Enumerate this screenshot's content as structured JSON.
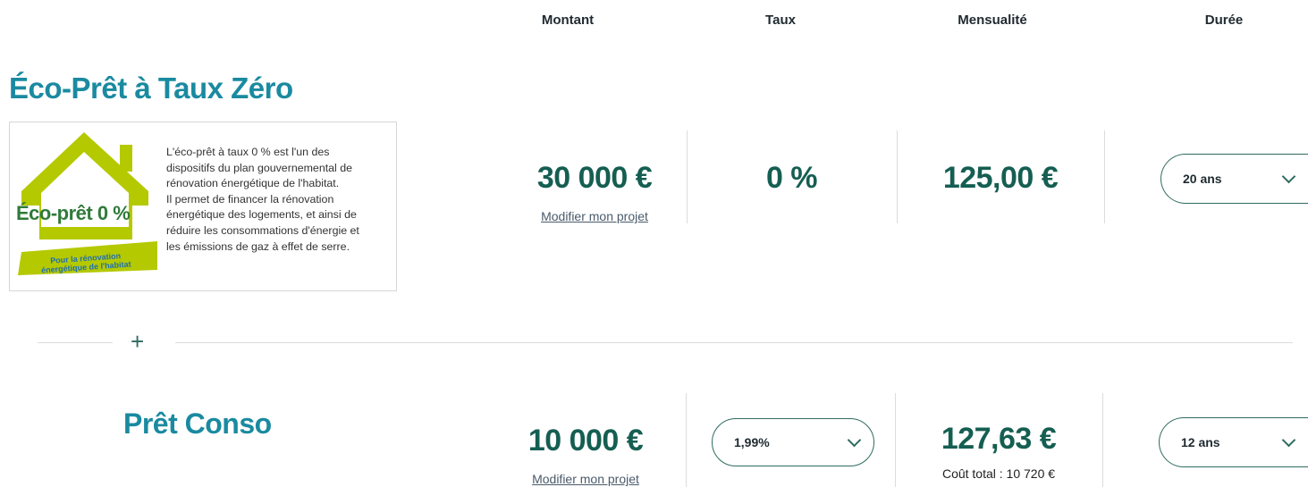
{
  "columns": {
    "montant": "Montant",
    "taux": "Taux",
    "mensualite": "Mensualité",
    "duree": "Durée"
  },
  "eco": {
    "title": "Éco-Prêt à Taux Zéro",
    "logo": {
      "name": "Éco-prêt 0 %",
      "tagline_line1": "Pour la rénovation",
      "tagline_line2": "énergétique de l'habitat"
    },
    "description_lines": [
      "L'éco-prêt à taux 0 % est l'un des",
      "dispositifs du plan gouvernemental de",
      "rénovation énergétique de l'habitat.",
      "Il permet de financer la rénovation",
      "énergétique des logements, et ainsi de",
      "réduire les consommations d'énergie et",
      "les émissions de gaz à effet de serre."
    ],
    "montant": "30 000 €",
    "modify_link": "Modifier mon projet",
    "taux": "0 %",
    "mensualite": "125,00 €",
    "duree": "20 ans"
  },
  "separator": {
    "plus": "+"
  },
  "conso": {
    "title": "Prêt Conso",
    "montant": "10 000 €",
    "modify_link": "Modifier mon projet",
    "taux": "1,99%",
    "mensualite": "127,63 €",
    "cout_total": "Coût total : 10 720 €",
    "duree": "12 ans"
  },
  "colors": {
    "title_blue": "#1a8aa0",
    "value_green": "#155e52",
    "logo_lime": "#b5c900",
    "logo_text_green": "#2f7a3a",
    "logo_tag_blue": "#1f6fb2",
    "separator_grey": "#d9dde0"
  }
}
